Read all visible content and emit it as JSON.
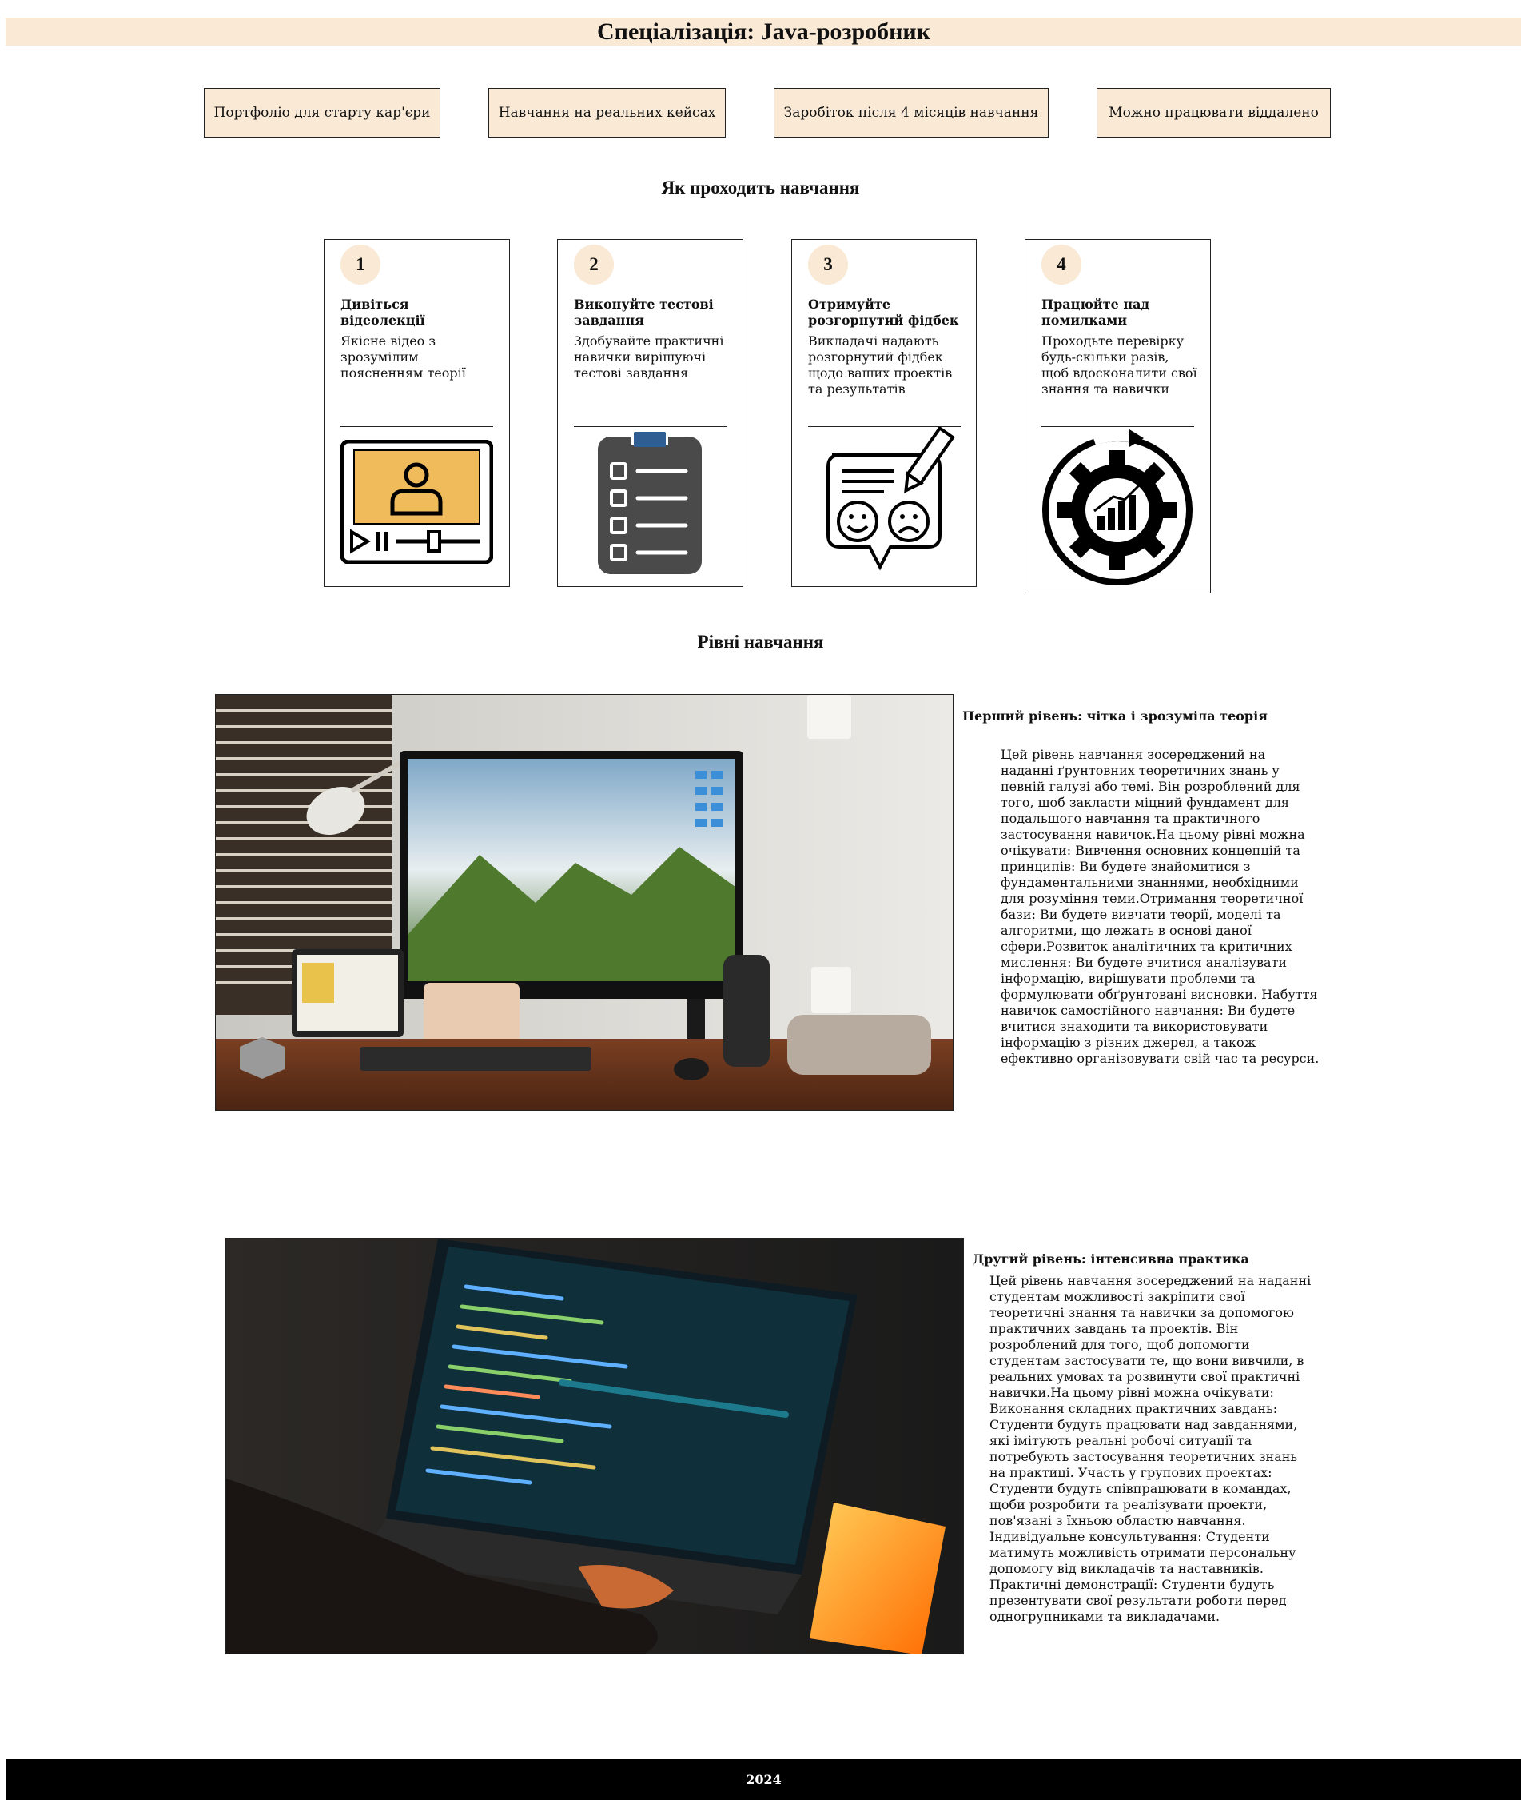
{
  "header": {
    "title": "Спеціалізація: Java-розробник"
  },
  "features": [
    "Портфоліо для старту кар'єри",
    "Навчання на реальних кейсах",
    "Заробіток після 4 місяців навчання",
    "Можно працювати віддалено"
  ],
  "process": {
    "title": "Як проходить навчання",
    "steps": [
      {
        "number": "1",
        "title": "Дивіться відеолекції",
        "desc": "Якісне відео з зрозумілим поясненням теорії",
        "icon": "video-lecture-icon"
      },
      {
        "number": "2",
        "title": "Виконуйте тестові завдання",
        "desc": "Здобувайте практичні навички вирішуючі тестові завдання",
        "icon": "clipboard-checklist-icon"
      },
      {
        "number": "3",
        "title": "Отримуйте розгорнутий фідбек",
        "desc": "Викладачі надають розгорнутий фідбек щодо ваших проектів та результатів",
        "icon": "feedback-icon"
      },
      {
        "number": "4",
        "title": "Працюйте над помилками",
        "desc": "Проходьте перевірку будь-скільки разів, щоб вдосконалити свої знання та навички",
        "icon": "gear-improvement-icon"
      }
    ]
  },
  "levels": {
    "title": "Рівні навчання",
    "items": [
      {
        "heading": "Перший рівень: чітка і зрозуміла теорія",
        "text": "Цей рівень навчання зосереджений на наданні ґрунтовних теоретичних знань у певній галузі або темі. Він розроблений для того, щоб закласти міцний фундамент для подальшого навчання та практичного застосування навичок.На цьому рівні можна очікувати: Вивчення основних концепцій та принципів: Ви будете знайомитися з фундаментальними знаннями, необхідними для розуміння теми.Отримання теоретичної бази: Ви будете вивчати теорії, моделі та алгоритми, що лежать в основі даної сфери.Розвиток аналітичних та критичних мислення: Ви будете вчитися аналізувати інформацію, вирішувати проблеми та формулювати обґрунтовані висновки. Набуття навичок самостійного навчання: Ви будете вчитися знаходити та використовувати інформацію з різних джерел, а також ефективно організовувати свій час та ресурси.",
        "image": "desk-monitor-photo"
      },
      {
        "heading": "Другий рівень: інтенсивна практика",
        "text": "Цей рівень навчання зосереджений на наданні студентам можливості закріпити свої теоретичні знання та навички за допомогою практичних завдань та проектів. Він розроблений для того, щоб допомогти студентам застосувати те, що вони вивчили, в реальних умовах та розвинути свої практичні навички.На цьому рівні можна очікувати: Виконання складних практичних завдань: Студенти будуть працювати над завданнями, які імітують реальні робочі ситуації та потребують застосування теоретичних знань на практиці. Участь у групових проектах: Студенти будуть співпрацювати в командах, щоби розробити та реалізувати проекти, пов'язані з їхньою областю навчання. Індивідуальне консультування: Студенти матимуть можливість отримати персональну допомогу від викладачів та наставників. Практичні демонстрації: Студенти будуть презентувати свої результати роботи перед одногрупниками та викладачами.",
        "image": "laptop-code-photo"
      }
    ]
  },
  "footer": {
    "year": "2024"
  },
  "colors": {
    "accent": "#f9e9d5",
    "footer_bg": "#000000",
    "icon_yellow": "#f0bb5b",
    "icon_blue": "#2f5f92",
    "icon_gray": "#4a4a4a"
  }
}
